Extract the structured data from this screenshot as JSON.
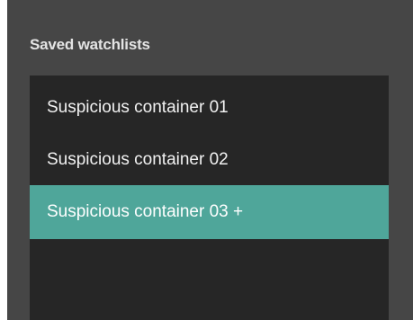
{
  "panel": {
    "title": "Saved watchlists"
  },
  "watchlists": [
    {
      "label": "Suspicious container 01",
      "selected": false
    },
    {
      "label": "Suspicious container 02",
      "selected": false
    },
    {
      "label": "Suspicious container 03 +",
      "selected": true
    }
  ],
  "colors": {
    "panel_bg": "#464646",
    "list_bg": "#262626",
    "selected_bg": "#4fa69a"
  }
}
